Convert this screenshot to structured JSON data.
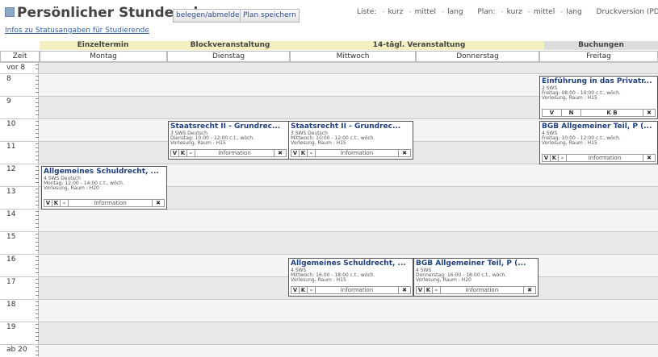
{
  "header": {
    "title": "Persönlicher Stundenplan",
    "btn_belegen": "belegen/abmelden",
    "btn_save": "Plan speichern",
    "liste_label": "Liste:",
    "plan_label": "Plan:",
    "kurz": "kurz",
    "mittel": "mittel",
    "lang": "lang",
    "sep": "-",
    "druck": "Druckversion (PDF)"
  },
  "info_link": "Infos zu Statusangaben für Studierende",
  "legend": [
    {
      "label": "Einzeltermin",
      "color": "#f5f0c0"
    },
    {
      "label": "Blockveranstaltung",
      "color": "#f5f0c0"
    },
    {
      "label": "14-tägl. Veranstaltung",
      "color": "#f5f0c0"
    },
    {
      "label": "Buchungen",
      "color": "#dddddd"
    }
  ],
  "columns": {
    "zeit": "Zeit",
    "days": [
      "Montag",
      "Dienstag",
      "Mittwoch",
      "Donnerstag",
      "Freitag"
    ]
  },
  "times": [
    "vor 8",
    "8",
    "9",
    "10",
    "11",
    "12",
    "13",
    "14",
    "15",
    "16",
    "17",
    "18",
    "19",
    "ab 20"
  ],
  "events": [
    {
      "title": "Einführung in das Privatr...",
      "lines": [
        "2 SWS",
        "Freitag: 08:00 - 10:00 c.t., wöch.",
        "Vorlesung, Raum : H15"
      ],
      "buttons": [
        "V",
        "N",
        "K B"
      ],
      "info": "",
      "close": "✖"
    },
    {
      "title": "BGB Allgemeiner Teil, P (...",
      "lines": [
        "4 SWS",
        "Freitag: 10:00 - 12:00 c.t., wöch.",
        "Vorlesung, Raum : H15"
      ],
      "buttons": [
        "V",
        "K",
        "-"
      ],
      "info": "Information",
      "close": "✖"
    },
    {
      "title": "Staatsrecht II - Grundrec...",
      "lines": [
        "3 SWS   Deutsch",
        "Dienstag: 10:00 - 12:00 c.t., wöch.",
        "Vorlesung, Raum : H15"
      ],
      "buttons": [
        "V",
        "K",
        "-"
      ],
      "info": "Information",
      "close": "✖"
    },
    {
      "title": "Staatsrecht II - Grundrec...",
      "lines": [
        "3 SWS   Deutsch",
        "Mittwoch: 10:00 - 12:00 c.t., wöch.",
        "Vorlesung, Raum : H15"
      ],
      "buttons": [
        "V",
        "K",
        "-"
      ],
      "info": "Information",
      "close": "✖"
    },
    {
      "title": "Allgemeines Schuldrecht, ...",
      "lines": [
        "4 SWS   Deutsch",
        "Montag: 12:00 - 14:00 c.t., wöch.",
        "Vorlesung, Raum : H20"
      ],
      "buttons": [
        "V",
        "K",
        "-"
      ],
      "info": "Information",
      "close": "✖"
    },
    {
      "title": "Allgemeines Schuldrecht, ...",
      "lines": [
        "4 SWS",
        "Mittwoch: 16:00 - 18:00 c.t., wöch.",
        "Vorlesung, Raum : H15"
      ],
      "buttons": [
        "V",
        "K",
        "-"
      ],
      "info": "Information",
      "close": "✖"
    },
    {
      "title": "BGB Allgemeiner Teil, P (...",
      "lines": [
        "4 SWS",
        "Donnerstag: 16:00 - 18:00 c.t., wöch.",
        "Vorlesung, Raum : H20"
      ],
      "buttons": [
        "V",
        "K",
        "-"
      ],
      "info": "Information",
      "close": "✖"
    }
  ]
}
